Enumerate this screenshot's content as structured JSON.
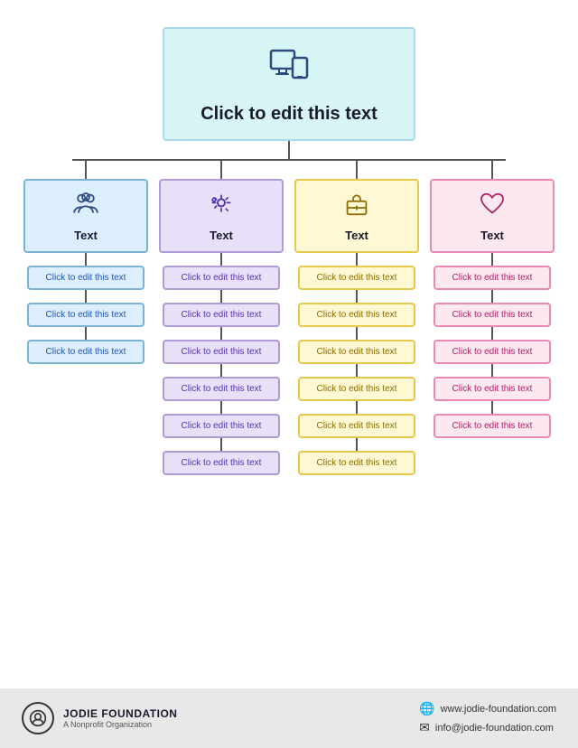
{
  "root": {
    "title": "Click to edit this text"
  },
  "columns": [
    {
      "id": "blue",
      "color": "blue",
      "icon": "people",
      "label": "Text",
      "children": [
        "Click to edit this text",
        "Click to edit this text",
        "Click to edit this text"
      ]
    },
    {
      "id": "purple",
      "color": "purple",
      "icon": "settings",
      "label": "Text",
      "children": [
        "Click to edit this text",
        "Click to edit this text",
        "Click to edit this text",
        "Click to edit this text",
        "Click to edit this text",
        "Click to edit this text"
      ]
    },
    {
      "id": "yellow",
      "color": "yellow",
      "icon": "briefcase",
      "label": "Text",
      "children": [
        "Click to edit this text",
        "Click to edit this text",
        "Click to edit this text",
        "Click to edit this text",
        "Click to edit this text",
        "Click to edit this text"
      ]
    },
    {
      "id": "pink",
      "color": "pink",
      "icon": "heart",
      "label": "Text",
      "children": [
        "Click to edit this text",
        "Click to edit this text",
        "Click to edit this text",
        "Click to edit this text",
        "Click to edit this text"
      ]
    }
  ],
  "footer": {
    "org_name": "JODIE FOUNDATION",
    "org_sub": "A Nonprofit Organization",
    "website": "www.jodie-foundation.com",
    "email": "info@jodie-foundation.com"
  }
}
